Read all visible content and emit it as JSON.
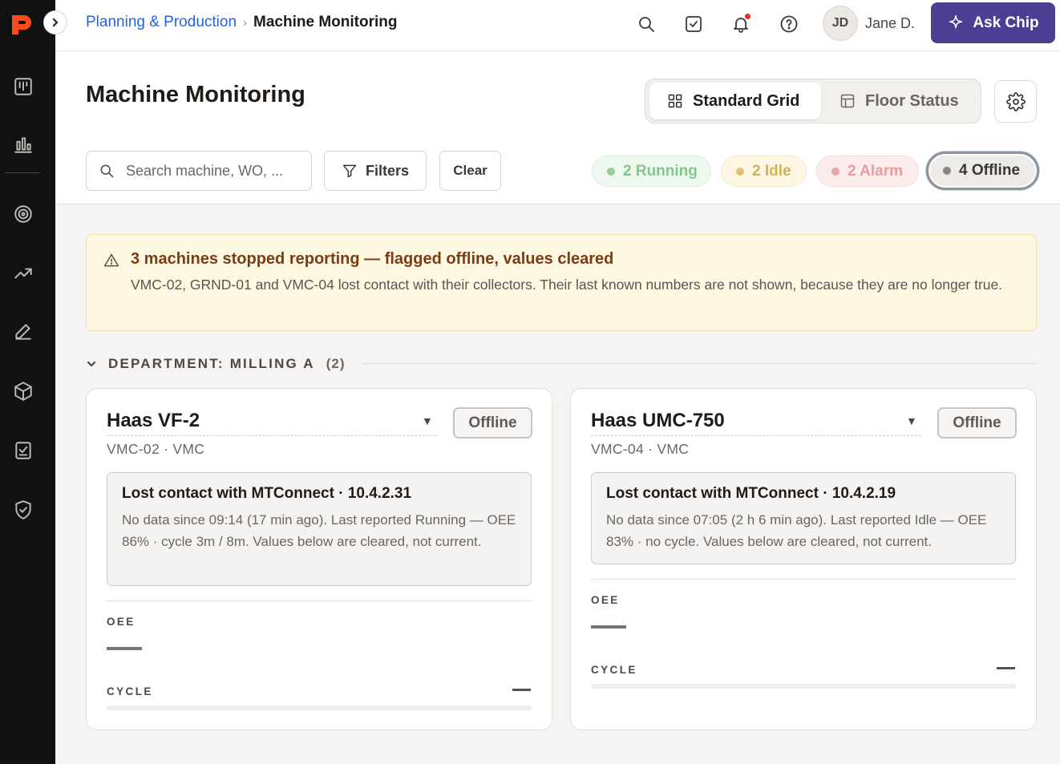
{
  "breadcrumb": {
    "parent": "Planning & Production",
    "current": "Machine Monitoring"
  },
  "user": {
    "initials": "JD",
    "name": "Jane D."
  },
  "ask_button": "Ask Chip",
  "page_title": "Machine Monitoring",
  "views": {
    "standard": "Standard Grid",
    "floor": "Floor Status"
  },
  "search": {
    "placeholder": "Search machine, WO, ..."
  },
  "filters_label": "Filters",
  "clear_label": "Clear",
  "status_chips": {
    "running": "2 Running",
    "idle": "2 Idle",
    "alarm": "2 Alarm",
    "offline": "4 Offline"
  },
  "banner": {
    "title": "3 machines stopped reporting — flagged offline, values cleared",
    "text": "VMC-02, GRND-01 and VMC-04 lost contact with their collectors. Their last known numbers are not shown, because they are no longer true."
  },
  "department": {
    "label": "DEPARTMENT: MILLING A",
    "count": "(2)"
  },
  "machines": [
    {
      "name": "Haas VF-2",
      "caret": "▼",
      "status": "Offline",
      "subtitle": "VMC-02 · VMC",
      "lost_title": "Lost contact with MTConnect · 10.4.2.31",
      "lost_text": "No data since 09:14 (17 min ago). Last reported Running — OEE 86% · cycle 3m / 8m. Values below are cleared, not current.",
      "oee_label": "OEE",
      "cycle_label": "CYCLE"
    },
    {
      "name": "Haas UMC-750",
      "caret": "▼",
      "status": "Offline",
      "subtitle": "VMC-04 · VMC",
      "lost_title": "Lost contact with MTConnect · 10.4.2.19",
      "lost_text": "No data since 07:05 (2 h 6 min ago). Last reported Idle — OEE 83% · no cycle. Values below are cleared, not current.",
      "oee_label": "OEE",
      "cycle_label": "CYCLE"
    }
  ],
  "colors": {
    "sidebar_bg": "#111111",
    "brand_orange": "#ff4a1c",
    "link_blue": "#2463d9",
    "ask_purple": "#4b3f93",
    "warning_bg": "#fdf8e2",
    "warning_title": "#7b3c14"
  }
}
